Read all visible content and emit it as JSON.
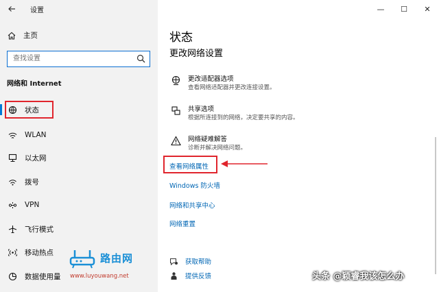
{
  "window": {
    "app_title": "设置",
    "minimize_glyph": "—",
    "maximize_glyph": "☐",
    "close_glyph": "✕"
  },
  "sidebar": {
    "home_label": "主页",
    "search_placeholder": "查找设置",
    "section_label": "网络和 Internet",
    "items": [
      {
        "label": "状态",
        "icon": "network-status-icon",
        "active": true
      },
      {
        "label": "WLAN",
        "icon": "wifi-icon"
      },
      {
        "label": "以太网",
        "icon": "ethernet-icon"
      },
      {
        "label": "拨号",
        "icon": "dialup-icon"
      },
      {
        "label": "VPN",
        "icon": "vpn-icon"
      },
      {
        "label": "飞行模式",
        "icon": "airplane-icon"
      },
      {
        "label": "移动热点",
        "icon": "hotspot-icon"
      },
      {
        "label": "数据使用量",
        "icon": "data-usage-icon"
      }
    ]
  },
  "watermark": {
    "name": "路由网",
    "url": "www.luyouwang.net"
  },
  "main": {
    "title": "状态",
    "subtitle": "更改网络设置",
    "options": [
      {
        "title": "更改适配器选项",
        "desc": "查看网络适配器并更改连接设置。",
        "icon": "adapter-icon"
      },
      {
        "title": "共享选项",
        "desc": "根据所连接到的网络，决定要共享的内容。",
        "icon": "sharing-icon"
      },
      {
        "title": "网络疑难解答",
        "desc": "诊断并解决网络问题。",
        "icon": "warning-icon"
      }
    ],
    "links": [
      "查看网络属性",
      "Windows 防火墙",
      "网络和共享中心",
      "网络重置"
    ],
    "help": [
      {
        "label": "获取帮助",
        "icon": "help-icon"
      },
      {
        "label": "提供反馈",
        "icon": "feedback-icon"
      }
    ]
  },
  "footer_watermark": "头条 @颖睿我该怎么办",
  "colors": {
    "accent": "#0078d7",
    "link": "#0066b4",
    "highlight": "#e0242c"
  }
}
